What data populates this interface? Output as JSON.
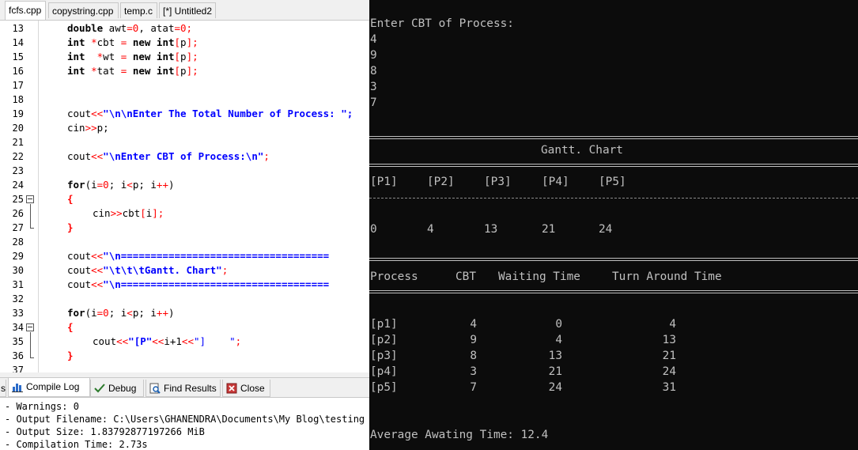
{
  "ide": {
    "tabs": [
      "fcfs.cpp",
      "copystring.cpp",
      "temp.c",
      "[*] Untitled2"
    ],
    "active_tab": "fcfs.cpp",
    "line_numbers": [
      "13",
      "14",
      "15",
      "16",
      "17",
      "18",
      "19",
      "20",
      "21",
      "22",
      "23",
      "24",
      "25",
      "26",
      "27",
      "28",
      "29",
      "30",
      "31",
      "32",
      "33",
      "34",
      "35",
      "36",
      "37"
    ],
    "code": {
      "l13": {
        "a": "double awt=0, atat=0;"
      },
      "l14": {
        "kw": "int",
        "b": " *cbt = ",
        "kw2": "new",
        "c": " ",
        "kw3": "int",
        "d": "[p];"
      },
      "l15": {
        "kw": "int",
        "b": "  *wt = ",
        "kw2": "new",
        "c": " ",
        "kw3": "int",
        "d": "[p];"
      },
      "l16": {
        "kw": "int",
        "b": " *tat = ",
        "kw2": "new",
        "c": " ",
        "kw3": "int",
        "d": "[p];"
      },
      "l19": {
        "a": "cout",
        "op": "<<",
        "s": "\"\\n\\nEnter The Total Number of Process: \";"
      },
      "l20": {
        "a": "cin",
        "op": ">>",
        "b": "p;"
      },
      "l22": {
        "a": "cout",
        "op": "<<",
        "s": "\"\\nEnter CBT of Process:\\n\"",
        "e": ";"
      },
      "l24": {
        "kw": "for",
        "b": "(i=0; i<p; i++)"
      },
      "l25": {
        "a": "{"
      },
      "l26": {
        "a": "cin",
        "op": ">>",
        "b": "cbt[i];"
      },
      "l27": {
        "a": "}"
      },
      "l29": {
        "a": "cout",
        "op": "<<",
        "s": "\"\\n==================================="
      },
      "l30": {
        "a": "cout",
        "op": "<<",
        "s": "\"\\t\\t\\tGantt. Chart\"",
        "e": ";"
      },
      "l31": {
        "a": "cout",
        "op": "<<",
        "s": "\"\\n==================================="
      },
      "l33": {
        "kw": "for",
        "b": "(i=0; i<p; i++)"
      },
      "l34": {
        "a": "{"
      },
      "l35": {
        "a": "cout",
        "op": "<<",
        "s1": "\"[P\"",
        "op2": "<<",
        "b": "i+1",
        "op3": "<<",
        "s2": "\"]    \"",
        "e": ";"
      },
      "l36": {
        "a": "}"
      }
    },
    "bottom_tabs": {
      "partial": "s",
      "compile_log": "Compile Log",
      "debug": "Debug",
      "find_results": "Find Results",
      "close": "Close"
    },
    "log_lines": [
      "- Warnings: 0",
      "- Output Filename: C:\\Users\\GHANENDRA\\Documents\\My Blog\\testing programs\\fcfs.exe",
      "- Output Size: 1.83792877197266 MiB",
      "- Compilation Time: 2.73s"
    ]
  },
  "console": {
    "prompt": "Enter CBT of Process:",
    "inputs": [
      "4",
      "9",
      "8",
      "3",
      "7"
    ],
    "gantt_title": "Gantt. Chart",
    "gantt_labels": [
      "[P1]",
      "[P2]",
      "[P3]",
      "[P4]",
      "[P5]"
    ],
    "gantt_times": [
      "0",
      "4",
      "13",
      "21",
      "24"
    ],
    "table_headers": {
      "process": "Process",
      "cbt": "CBT",
      "waiting": "Waiting Time",
      "tat": "Turn Around Time"
    },
    "rows": [
      {
        "p": "[p1]",
        "cbt": "4",
        "wt": "0",
        "tat": "4"
      },
      {
        "p": "[p2]",
        "cbt": "9",
        "wt": "4",
        "tat": "13"
      },
      {
        "p": "[p3]",
        "cbt": "8",
        "wt": "13",
        "tat": "21"
      },
      {
        "p": "[p4]",
        "cbt": "3",
        "wt": "21",
        "tat": "24"
      },
      {
        "p": "[p5]",
        "cbt": "7",
        "wt": "24",
        "tat": "31"
      }
    ],
    "average_waiting": "Average Awating Time: 12.4"
  },
  "colors": {
    "keyword": "#000000",
    "operator": "#ff0000",
    "string": "#0000ff",
    "console_bg": "#0c0c0c",
    "console_fg": "#c0c0c0"
  }
}
